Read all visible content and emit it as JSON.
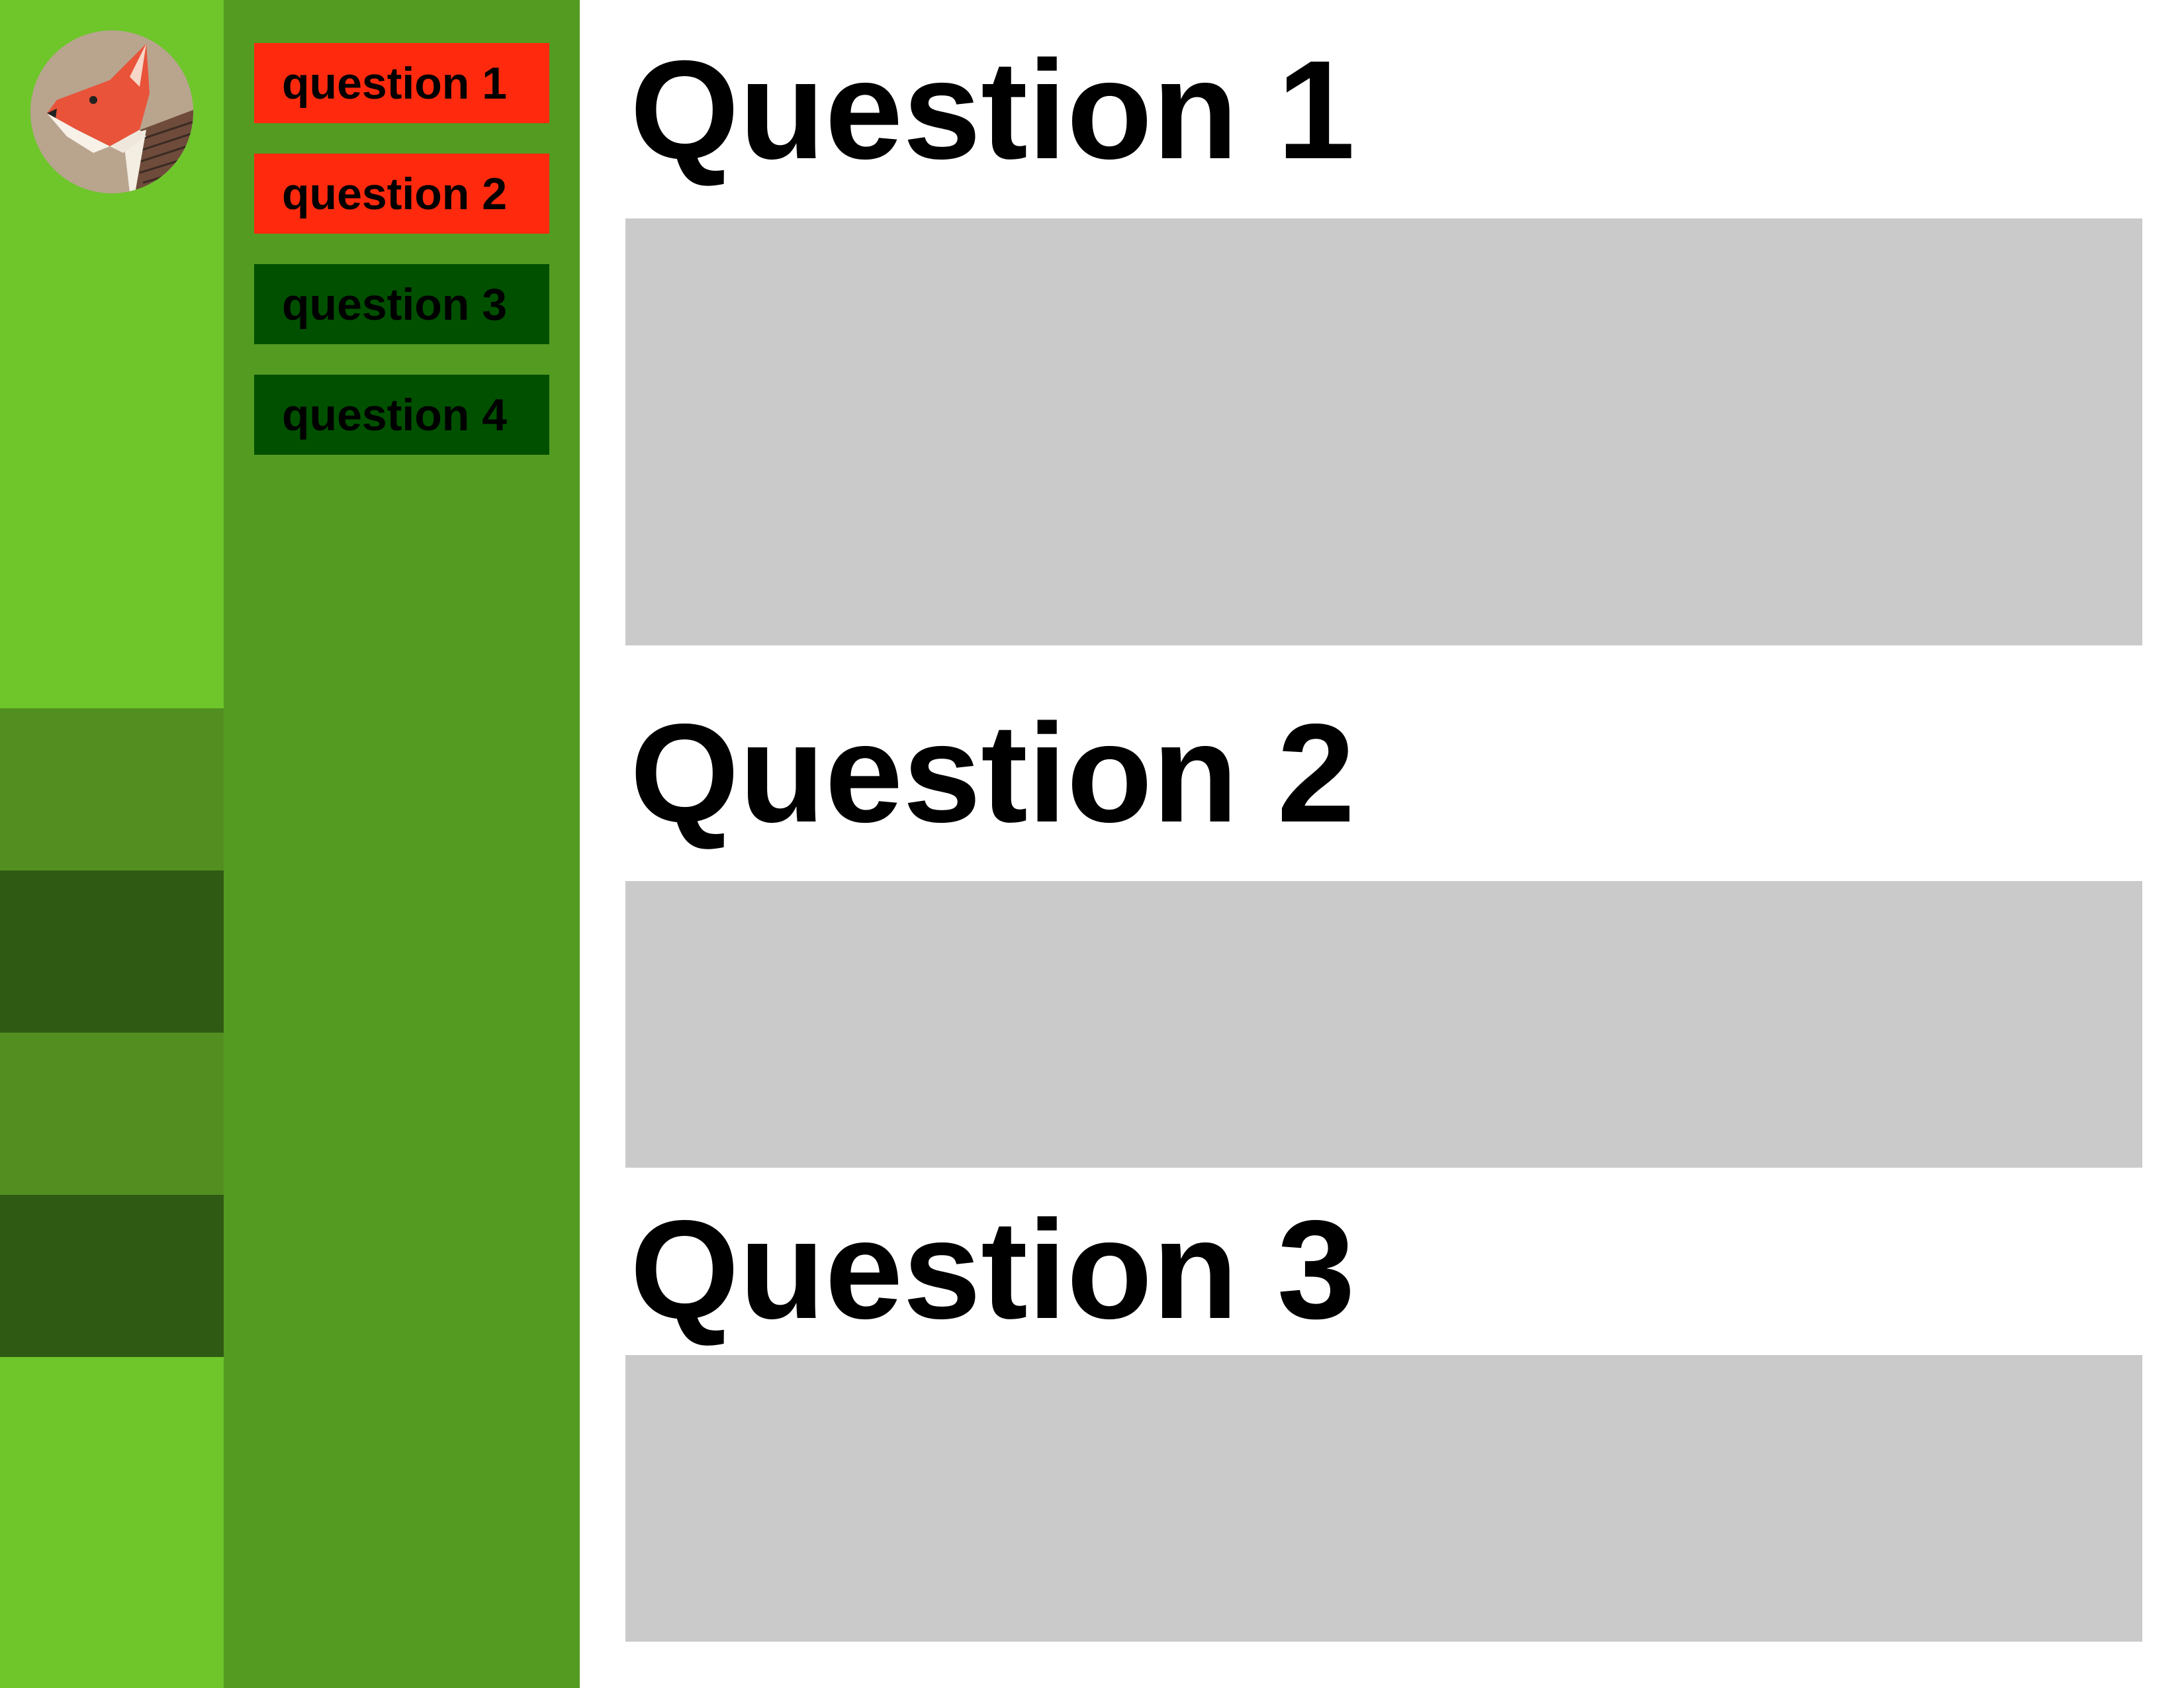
{
  "nav": {
    "buttons": [
      {
        "label": "question 1",
        "state": "red"
      },
      {
        "label": "question 2",
        "state": "red"
      },
      {
        "label": "question 3",
        "state": "dark"
      },
      {
        "label": "question 4",
        "state": "dark"
      }
    ]
  },
  "main": {
    "sections": [
      {
        "title": "Question 1"
      },
      {
        "title": "Question 2"
      },
      {
        "title": "Question 3"
      }
    ]
  },
  "colors": {
    "rail": "#6ec62b",
    "nav_panel": "#549b22",
    "active": "#ff2a0e",
    "inactive": "#005000",
    "answer_box": "#cacaca"
  },
  "icons": {
    "avatar": "fox-avatar-icon"
  }
}
